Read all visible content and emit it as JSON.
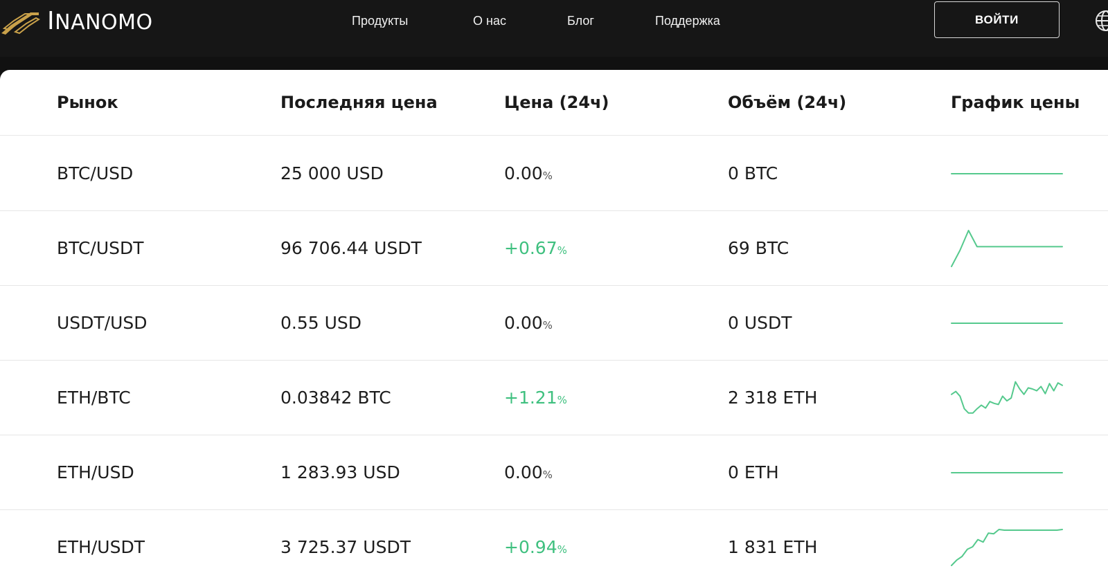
{
  "brand": {
    "initial": "I",
    "rest": "NANOMO",
    "accent": "#c9a14a"
  },
  "nav": [
    {
      "label": "Продукты"
    },
    {
      "label": "О нас"
    },
    {
      "label": "Блог"
    },
    {
      "label": "Поддержка"
    }
  ],
  "login_label": "ВОЙТИ",
  "table": {
    "headers": [
      "Рынок",
      "Последняя цена",
      "Цена (24ч)",
      "Объём (24ч)",
      "График цены"
    ],
    "rows": [
      {
        "market": "BTC/USD",
        "price": "25 000 USD",
        "change": "0.00",
        "trend": "neutral",
        "volume": "0 BTC",
        "spark": [
          0,
          0,
          0,
          0,
          0,
          0,
          0,
          0,
          0,
          0,
          0,
          0
        ]
      },
      {
        "market": "BTC/USDT",
        "price": "96 706.44 USDT",
        "change": "+0.67",
        "trend": "positive",
        "volume": "69 BTC",
        "spark": [
          0.0,
          0.45,
          1.0,
          0.55,
          0.55,
          0.55,
          0.55,
          0.55,
          0.55,
          0.55,
          0.55,
          0.55,
          0.55,
          0.55
        ]
      },
      {
        "market": "USDT/USD",
        "price": "0.55 USD",
        "change": "0.00",
        "trend": "neutral",
        "volume": "0 USDT",
        "spark": [
          0,
          0,
          0,
          0,
          0,
          0,
          0,
          0,
          0,
          0,
          0,
          0
        ]
      },
      {
        "market": "ETH/BTC",
        "price": "0.03842 BTC",
        "change": "+1.21",
        "trend": "positive",
        "volume": "2 318 ETH",
        "spark": [
          0.6,
          0.68,
          0.55,
          0.2,
          0.08,
          0.08,
          0.2,
          0.3,
          0.22,
          0.4,
          0.35,
          0.32,
          0.55,
          0.42,
          0.5,
          0.95,
          0.75,
          0.6,
          0.78,
          0.75,
          0.7,
          0.82,
          0.62,
          0.9,
          0.7,
          0.92,
          0.85
        ]
      },
      {
        "market": "ETH/USD",
        "price": "1 283.93 USD",
        "change": "0.00",
        "trend": "neutral",
        "volume": "0 ETH",
        "spark": [
          0,
          0,
          0,
          0,
          0,
          0,
          0,
          0,
          0,
          0,
          0,
          0
        ]
      },
      {
        "market": "ETH/USDT",
        "price": "3 725.37 USDT",
        "change": "+0.94",
        "trend": "positive",
        "volume": "1 831 ETH",
        "spark": [
          0.0,
          0.15,
          0.25,
          0.45,
          0.52,
          0.72,
          0.65,
          0.9,
          0.88,
          1.0,
          0.98,
          0.98,
          0.98,
          0.98,
          0.98,
          0.98,
          0.98,
          0.98,
          0.98,
          0.98,
          0.98,
          1.0
        ]
      }
    ]
  },
  "colors": {
    "positive": "#3fc07f",
    "spark": "#55c98d",
    "header_bg": "#161616"
  }
}
